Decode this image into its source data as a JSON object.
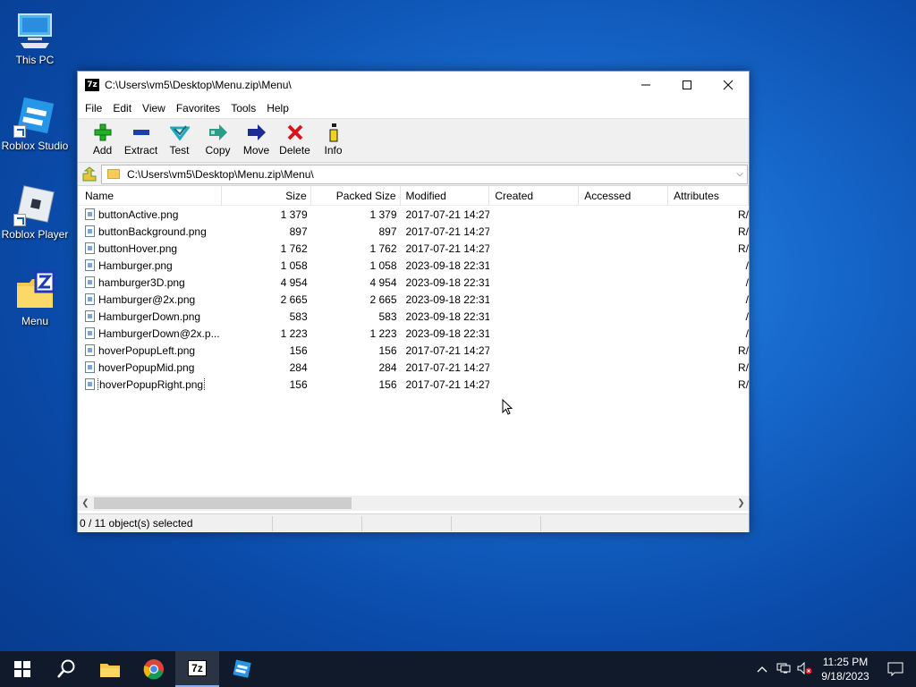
{
  "desktop": {
    "icons": [
      {
        "label": "This PC",
        "icon": "this-pc-icon"
      },
      {
        "label": "Roblox Studio",
        "icon": "roblox-studio-icon"
      },
      {
        "label": "Roblox Player",
        "icon": "roblox-player-icon"
      },
      {
        "label": "Menu",
        "icon": "zip-folder-icon"
      }
    ]
  },
  "window": {
    "title": "C:\\Users\\vm5\\Desktop\\Menu.zip\\Menu\\",
    "app_icon_text": "7z",
    "menu": [
      "File",
      "Edit",
      "View",
      "Favorites",
      "Tools",
      "Help"
    ],
    "toolbar": [
      "Add",
      "Extract",
      "Test",
      "Copy",
      "Move",
      "Delete",
      "Info"
    ],
    "address": "C:\\Users\\vm5\\Desktop\\Menu.zip\\Menu\\",
    "columns": [
      "Name",
      "Size",
      "Packed Size",
      "Modified",
      "Created",
      "Accessed",
      "Attributes"
    ],
    "files": [
      {
        "name": "buttonActive.png",
        "size": "1 379",
        "packed": "1 379",
        "modified": "2017-07-21 14:27",
        "attr": "R/"
      },
      {
        "name": "buttonBackground.png",
        "size": "897",
        "packed": "897",
        "modified": "2017-07-21 14:27",
        "attr": "R/"
      },
      {
        "name": "buttonHover.png",
        "size": "1 762",
        "packed": "1 762",
        "modified": "2017-07-21 14:27",
        "attr": "R/"
      },
      {
        "name": "Hamburger.png",
        "size": "1 058",
        "packed": "1 058",
        "modified": "2023-09-18 22:31",
        "attr": "/"
      },
      {
        "name": "hamburger3D.png",
        "size": "4 954",
        "packed": "4 954",
        "modified": "2023-09-18 22:31",
        "attr": "/"
      },
      {
        "name": "Hamburger@2x.png",
        "size": "2 665",
        "packed": "2 665",
        "modified": "2023-09-18 22:31",
        "attr": "/"
      },
      {
        "name": "HamburgerDown.png",
        "size": "583",
        "packed": "583",
        "modified": "2023-09-18 22:31",
        "attr": "/"
      },
      {
        "name": "HamburgerDown@2x.p...",
        "size": "1 223",
        "packed": "1 223",
        "modified": "2023-09-18 22:31",
        "attr": "/"
      },
      {
        "name": "hoverPopupLeft.png",
        "size": "156",
        "packed": "156",
        "modified": "2017-07-21 14:27",
        "attr": "R/"
      },
      {
        "name": "hoverPopupMid.png",
        "size": "284",
        "packed": "284",
        "modified": "2017-07-21 14:27",
        "attr": "R/"
      },
      {
        "name": "hoverPopupRight.png",
        "size": "156",
        "packed": "156",
        "modified": "2017-07-21 14:27",
        "attr": "R/"
      }
    ],
    "status": "0 / 11 object(s) selected"
  },
  "taskbar": {
    "time": "11:25 PM",
    "date": "9/18/2023",
    "active_app_label": "7z"
  },
  "colors": {
    "desktop_blue": "#1565c8",
    "taskbar": "#101a2a",
    "window_chrome": "#f0f0f0"
  }
}
